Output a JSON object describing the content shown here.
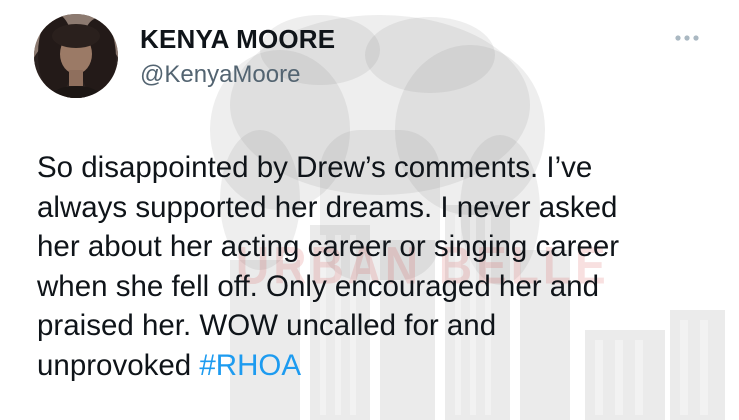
{
  "tweet": {
    "author": {
      "display_name": "KENYA MOORE",
      "handle": "@KenyaMoore",
      "avatar_icon": "profile-photo"
    },
    "more_icon": "ellipsis-icon",
    "text_lines": [
      "So disappointed by Drew’s comments. I’ve",
      "always supported her dreams. I never asked",
      "her about her acting career or singing career",
      "when she fell off. Only encouraged her and",
      "praised her. WOW uncalled for and",
      "unprovoked"
    ],
    "hashtag": "#RHOA"
  },
  "watermark": {
    "text": "URBAN BELLE"
  },
  "colors": {
    "text": "#0f1419",
    "secondary": "#536471",
    "link": "#1d9bf0"
  }
}
